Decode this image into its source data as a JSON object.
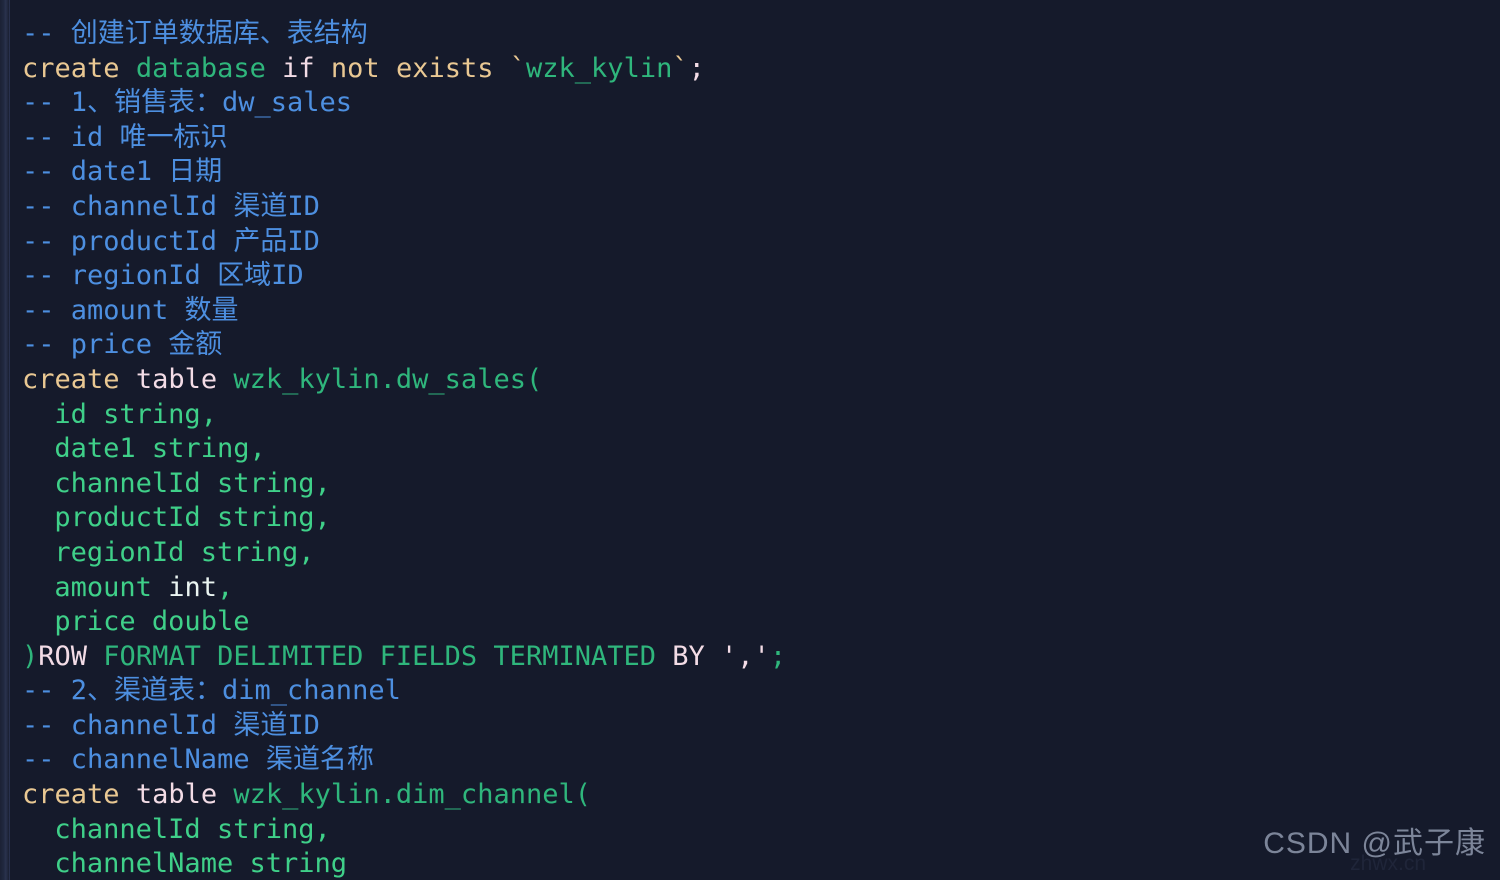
{
  "editor": {
    "background_color": "#151a2b",
    "font_size_px": 27,
    "line_height_px": 34.6,
    "language": "sql"
  },
  "palette": {
    "comment": "#4d8fe0",
    "keyword_orange": "#e9c893",
    "keyword_pink": "#f3dce6",
    "identifier_green": "#2fb67c",
    "type_white": "#eaf4f1",
    "string_pink": "#f3dce6",
    "background": "#151a2b"
  },
  "code": {
    "lines": [
      {
        "id": 1,
        "indent": 0,
        "tokens": [
          {
            "t": "-- 创建订单数据库、表结构",
            "c": "c-comment"
          }
        ]
      },
      {
        "id": 2,
        "indent": 0,
        "tokens": [
          {
            "t": "create",
            "c": "c-kw"
          },
          {
            "t": " ",
            "c": "c-plain"
          },
          {
            "t": "database",
            "c": "c-ident"
          },
          {
            "t": " ",
            "c": "c-plain"
          },
          {
            "t": "if",
            "c": "c-kw2"
          },
          {
            "t": " ",
            "c": "c-plain"
          },
          {
            "t": "not",
            "c": "c-kw"
          },
          {
            "t": " ",
            "c": "c-plain"
          },
          {
            "t": "exists",
            "c": "c-kw"
          },
          {
            "t": " ",
            "c": "c-plain"
          },
          {
            "t": "`",
            "c": "c-kw"
          },
          {
            "t": "wzk_kylin",
            "c": "c-ident"
          },
          {
            "t": "`",
            "c": "c-kw"
          },
          {
            "t": ";",
            "c": "c-plain"
          }
        ]
      },
      {
        "id": 3,
        "indent": 0,
        "tokens": [
          {
            "t": "-- 1、销售表：dw_sales",
            "c": "c-comment"
          }
        ]
      },
      {
        "id": 4,
        "indent": 0,
        "tokens": [
          {
            "t": "-- id 唯一标识",
            "c": "c-comment"
          }
        ]
      },
      {
        "id": 5,
        "indent": 0,
        "tokens": [
          {
            "t": "-- date1 日期",
            "c": "c-comment"
          }
        ]
      },
      {
        "id": 6,
        "indent": 0,
        "tokens": [
          {
            "t": "-- channelId 渠道ID",
            "c": "c-comment"
          }
        ]
      },
      {
        "id": 7,
        "indent": 0,
        "tokens": [
          {
            "t": "-- productId 产品ID",
            "c": "c-comment"
          }
        ]
      },
      {
        "id": 8,
        "indent": 0,
        "tokens": [
          {
            "t": "-- regionId 区域ID",
            "c": "c-comment"
          }
        ]
      },
      {
        "id": 9,
        "indent": 0,
        "tokens": [
          {
            "t": "-- amount 数量",
            "c": "c-comment"
          }
        ]
      },
      {
        "id": 10,
        "indent": 0,
        "tokens": [
          {
            "t": "-- price 金额",
            "c": "c-comment"
          }
        ]
      },
      {
        "id": 11,
        "indent": 0,
        "tokens": [
          {
            "t": "create",
            "c": "c-kw"
          },
          {
            "t": " ",
            "c": "c-plain"
          },
          {
            "t": "table",
            "c": "c-kw2"
          },
          {
            "t": " ",
            "c": "c-plain"
          },
          {
            "t": "wzk_kylin.dw_sales(",
            "c": "c-ident"
          }
        ]
      },
      {
        "id": 12,
        "indent": 2,
        "tokens": [
          {
            "t": "id string,",
            "c": "c-greenlt"
          }
        ]
      },
      {
        "id": 13,
        "indent": 2,
        "tokens": [
          {
            "t": "date1 string,",
            "c": "c-greenlt"
          }
        ]
      },
      {
        "id": 14,
        "indent": 2,
        "tokens": [
          {
            "t": "channelId string,",
            "c": "c-greenlt"
          }
        ]
      },
      {
        "id": 15,
        "indent": 2,
        "tokens": [
          {
            "t": "productId string,",
            "c": "c-greenlt"
          }
        ]
      },
      {
        "id": 16,
        "indent": 2,
        "tokens": [
          {
            "t": "regionId string,",
            "c": "c-greenlt"
          }
        ]
      },
      {
        "id": 17,
        "indent": 2,
        "tokens": [
          {
            "t": "amount ",
            "c": "c-greenlt"
          },
          {
            "t": "int",
            "c": "c-type"
          },
          {
            "t": ",",
            "c": "c-greenlt"
          }
        ]
      },
      {
        "id": 18,
        "indent": 2,
        "tokens": [
          {
            "t": "price double",
            "c": "c-greenlt"
          }
        ]
      },
      {
        "id": 19,
        "indent": 0,
        "tokens": [
          {
            "t": ")",
            "c": "c-punc"
          },
          {
            "t": "ROW",
            "c": "c-kw2"
          },
          {
            "t": " FORMAT DELIMITED FIELDS TERMINATED ",
            "c": "c-green"
          },
          {
            "t": "BY",
            "c": "c-kw2"
          },
          {
            "t": " ",
            "c": "c-plain"
          },
          {
            "t": "','",
            "c": "c-str"
          },
          {
            "t": ";",
            "c": "c-green"
          }
        ]
      },
      {
        "id": 20,
        "indent": 0,
        "tokens": [
          {
            "t": "-- 2、渠道表：dim_channel",
            "c": "c-comment"
          }
        ]
      },
      {
        "id": 21,
        "indent": 0,
        "tokens": [
          {
            "t": "-- channelId 渠道ID",
            "c": "c-comment"
          }
        ]
      },
      {
        "id": 22,
        "indent": 0,
        "tokens": [
          {
            "t": "-- channelName 渠道名称",
            "c": "c-comment"
          }
        ]
      },
      {
        "id": 23,
        "indent": 0,
        "tokens": [
          {
            "t": "create",
            "c": "c-kw"
          },
          {
            "t": " ",
            "c": "c-plain"
          },
          {
            "t": "table",
            "c": "c-kw2"
          },
          {
            "t": " ",
            "c": "c-plain"
          },
          {
            "t": "wzk_kylin.dim_channel(",
            "c": "c-ident"
          }
        ]
      },
      {
        "id": 24,
        "indent": 2,
        "tokens": [
          {
            "t": "channelId string,",
            "c": "c-greenlt"
          }
        ]
      },
      {
        "id": 25,
        "indent": 2,
        "tokens": [
          {
            "t": "channelName string",
            "c": "c-greenlt"
          }
        ]
      }
    ]
  },
  "watermark": {
    "main": "CSDN @武子康",
    "overlay": "zhwx.cn"
  }
}
